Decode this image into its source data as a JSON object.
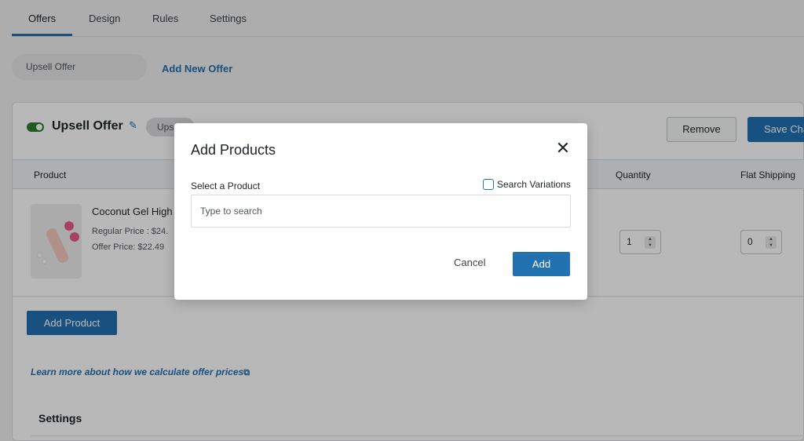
{
  "tabs": [
    "Offers",
    "Design",
    "Rules",
    "Settings"
  ],
  "offers": {
    "pill_label": "Upsell Offer",
    "add_new_label": "Add New Offer"
  },
  "offer_card": {
    "title": "Upsell Offer",
    "type_badge": "Upsell",
    "remove_label": "Remove",
    "save_label": "Save Changes",
    "columns": {
      "product": "Product",
      "quantity": "Quantity",
      "flat_shipping": "Flat Shipping"
    },
    "product": {
      "name": "Coconut Gel High",
      "regular_price": "Regular Price : $24.",
      "offer_price": "Offer Price: $22.49",
      "quantity": "1",
      "flat_shipping": "0"
    },
    "add_product_label": "Add Product",
    "learn_more_label": "Learn more about how we calculate offer prices",
    "settings_heading": "Settings"
  },
  "modal": {
    "title": "Add Products",
    "select_label": "Select a Product",
    "search_variations_label": "Search Variations",
    "search_variations_checked": false,
    "search_placeholder": "Type to search",
    "cancel_label": "Cancel",
    "add_label": "Add"
  },
  "colors": {
    "accent": "#2271b1",
    "toggle_on": "#2e7d32"
  }
}
